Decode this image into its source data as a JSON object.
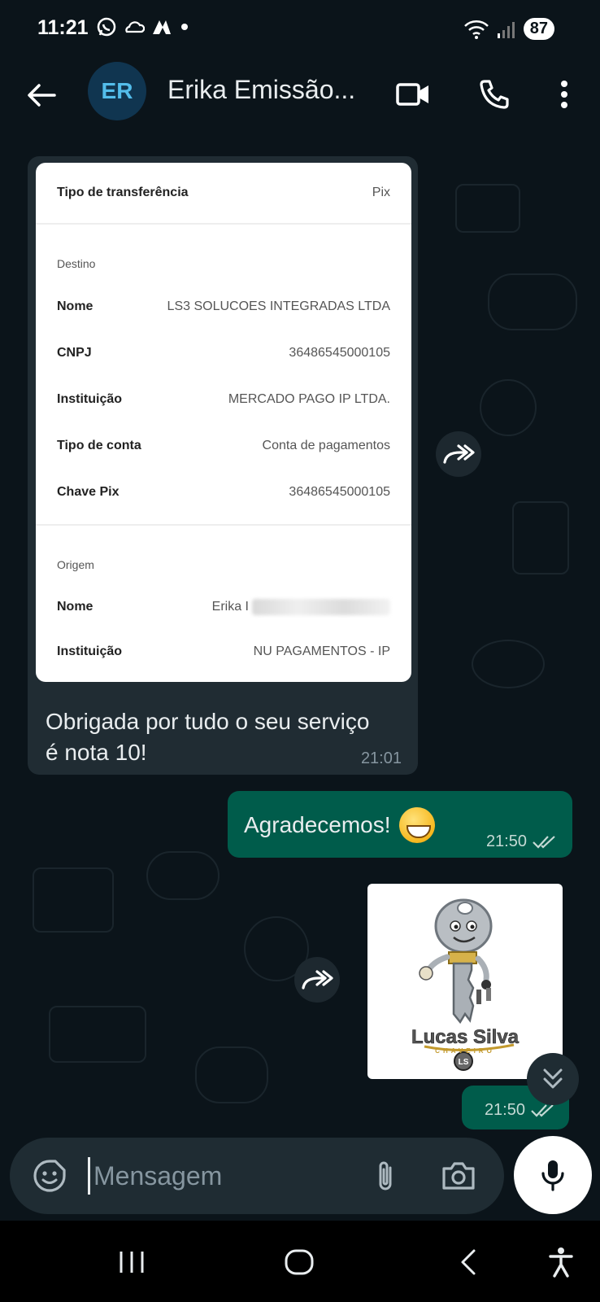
{
  "status_bar": {
    "time": "11:21",
    "battery": "87",
    "left_icons": [
      "whatsapp-icon",
      "cloud-icon",
      "arrow-logo-icon",
      "dot-icon"
    ],
    "right_icons": [
      "wifi-icon",
      "signal-icon"
    ]
  },
  "header": {
    "avatar_initials": "ER",
    "contact_name": "Erika Emissão...",
    "icons": [
      "back-arrow-icon",
      "video-call-icon",
      "phone-icon",
      "more-options-icon"
    ]
  },
  "receipt": {
    "transfer_type_label": "Tipo de transferência",
    "transfer_type_value": "Pix",
    "destino_title": "Destino",
    "destino": {
      "nome_label": "Nome",
      "nome_value": "LS3 SOLUCOES INTEGRADAS LTDA",
      "cnpj_label": "CNPJ",
      "cnpj_value": "36486545000105",
      "instituicao_label": "Instituição",
      "instituicao_value": "MERCADO PAGO IP LTDA.",
      "tipo_conta_label": "Tipo de conta",
      "tipo_conta_value": "Conta de pagamentos",
      "chave_label": "Chave Pix",
      "chave_value": "36486545000105"
    },
    "origem_title": "Origem",
    "origem": {
      "nome_label": "Nome",
      "nome_value": "Erika I",
      "instituicao_label": "Instituição",
      "instituicao_value": "NU PAGAMENTOS - IP"
    }
  },
  "messages": {
    "incoming_text": "Obrigada por tudo o seu serviço é nota 10!",
    "incoming_time": "21:01",
    "outgoing_text": "Agradecemos!",
    "outgoing_time": "21:50",
    "image_time": "21:50",
    "image_logo_text": "Lucas Silva",
    "image_logo_sub": "CHAVEIRO",
    "image_logo_badge": "LS"
  },
  "composer": {
    "placeholder": "Mensagem",
    "icons": [
      "sticker-icon",
      "attach-icon",
      "camera-icon",
      "mic-icon"
    ]
  },
  "colors": {
    "background": "#0b141a",
    "incoming_bubble": "#202c33",
    "outgoing_bubble": "#005c4b",
    "accent": "#53bdeb"
  }
}
